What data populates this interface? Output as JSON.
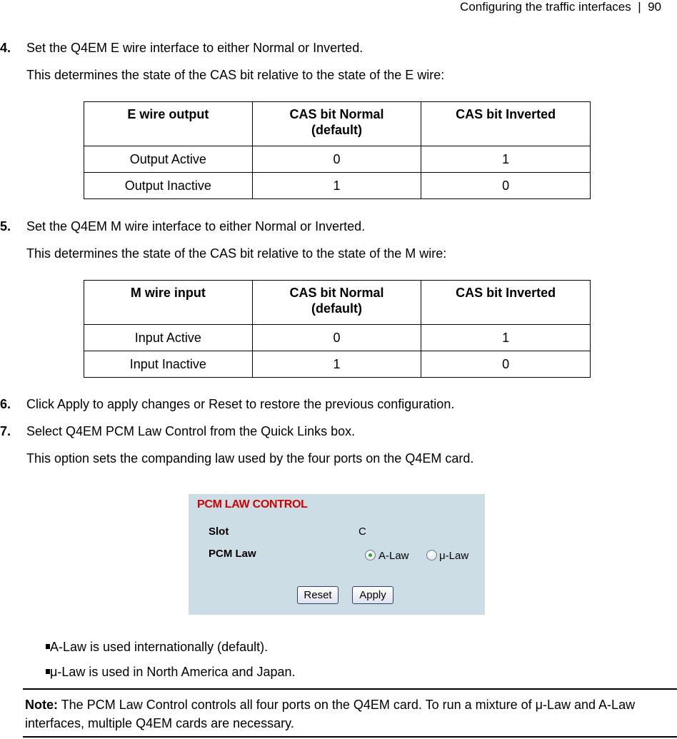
{
  "header": {
    "section": "Configuring the traffic interfaces",
    "separator": "|",
    "page": "90"
  },
  "steps": [
    {
      "num": "4.",
      "text": "Set the Q4EM E wire interface to either Normal or Inverted.",
      "sub": "This determines the state of the CAS bit relative to the state of the E wire:"
    },
    {
      "num": "5.",
      "text": "Set the Q4EM M wire interface to either Normal or Inverted.",
      "sub": "This determines the state of the CAS bit relative to the state of the M wire:"
    },
    {
      "num": "6.",
      "text": "Click Apply to apply changes or Reset to restore the previous configuration."
    },
    {
      "num": "7.",
      "text": "Select Q4EM PCM Law Control from the Quick Links box.",
      "sub": "This option sets the companding law used by the four ports on the Q4EM card."
    }
  ],
  "table_e": {
    "headers": [
      "E wire output",
      "CAS bit Normal (default)",
      "CAS bit Inverted"
    ],
    "rows": [
      [
        "Output Active",
        "0",
        "1"
      ],
      [
        "Output Inactive",
        "1",
        "0"
      ]
    ]
  },
  "table_m": {
    "headers": [
      "M wire input",
      "CAS bit Normal (default)",
      "CAS bit Inverted"
    ],
    "rows": [
      [
        "Input Active",
        "0",
        "1"
      ],
      [
        "Input Inactive",
        "1",
        "0"
      ]
    ]
  },
  "pcm_panel": {
    "title": "PCM LAW CONTROL",
    "slot_label": "Slot",
    "slot_value": "C",
    "law_label": "PCM Law",
    "options": [
      {
        "label": "A-Law",
        "selected": true
      },
      {
        "label": "μ-Law",
        "selected": false
      }
    ],
    "reset_label": "Reset",
    "apply_label": "Apply",
    "colors": {
      "background": "#ccdde6",
      "title": "#d00000",
      "radio_dot": "#2ca52c"
    }
  },
  "bullets": [
    "A-Law is used internationally (default).",
    "μ-Law is used in North America and Japan."
  ],
  "note": {
    "label": "Note:",
    "text": " The PCM Law Control controls all four ports on the Q4EM card. To run a mixture of μ-Law and A-Law interfaces, multiple Q4EM cards are necessary."
  }
}
